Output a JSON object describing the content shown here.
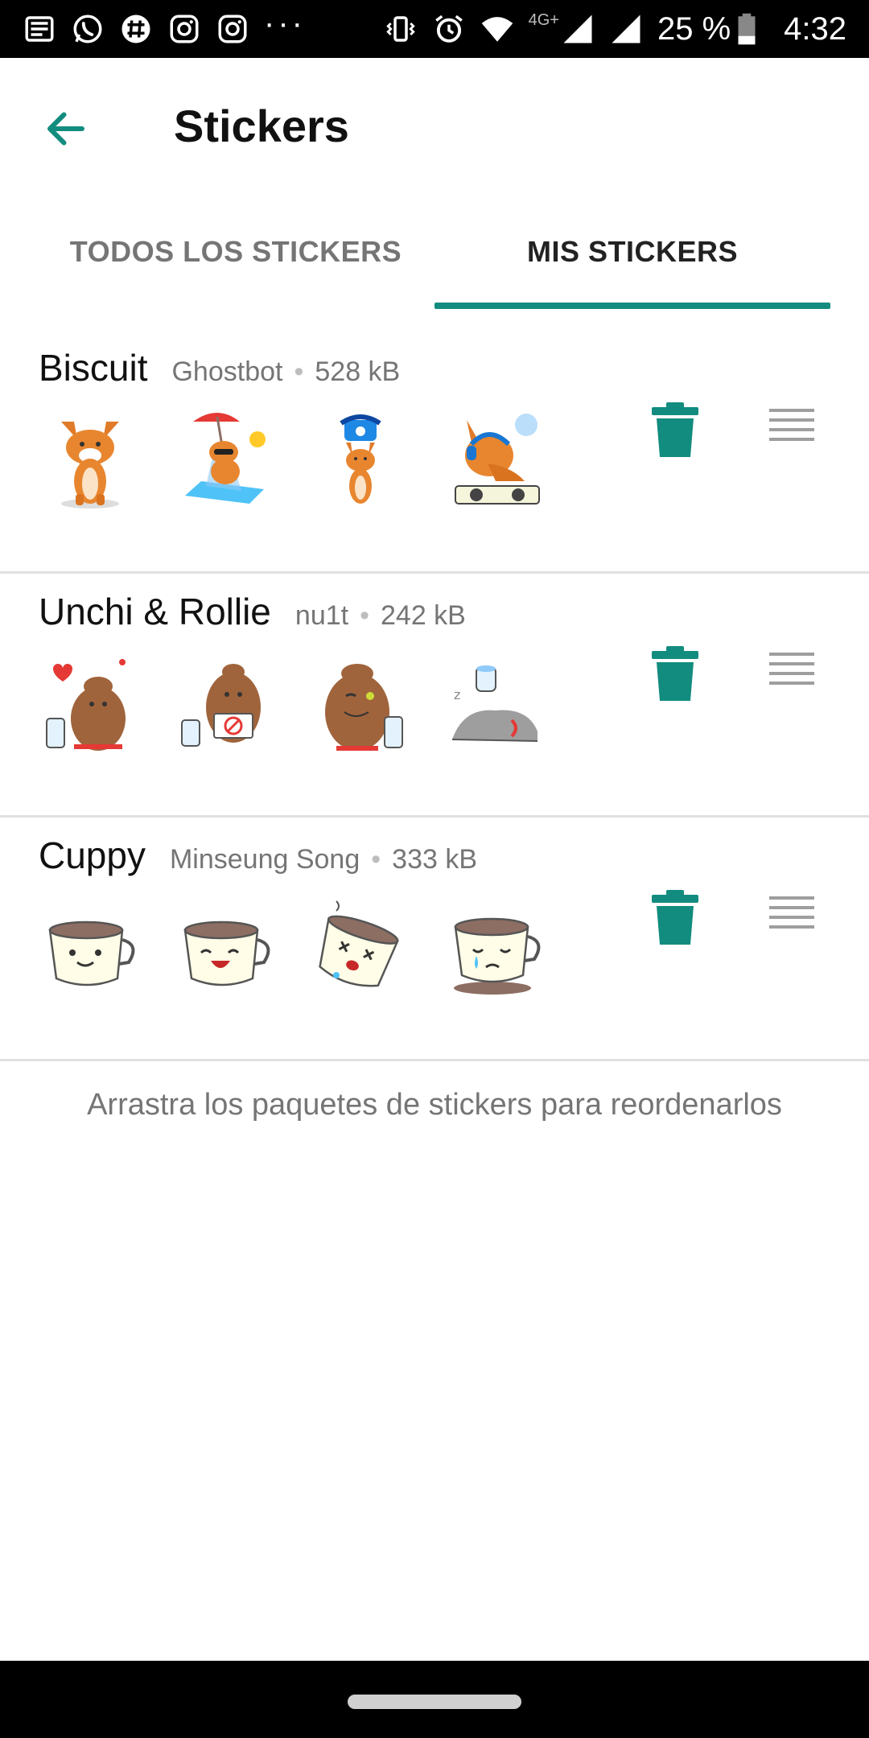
{
  "status_bar": {
    "left_icons": [
      "news-icon",
      "whatsapp-icon",
      "slack-icon",
      "instagram-icon",
      "instagram-icon",
      "more-dots-icon"
    ],
    "more_dots": "···",
    "network_label": "4G+",
    "battery_percent": "25 %",
    "time": "4:32"
  },
  "app_bar": {
    "back_icon": "arrow-back-icon",
    "title": "Stickers"
  },
  "tabs": [
    {
      "label": "TODOS LOS STICKERS",
      "selected": false
    },
    {
      "label": "MIS STICKERS",
      "selected": true
    }
  ],
  "packs": [
    {
      "name": "Biscuit",
      "author": "Ghostbot",
      "size": "528 kB",
      "stickers": [
        "fox-sitting",
        "fox-beach",
        "fox-phone",
        "fox-dj"
      ]
    },
    {
      "name": "Unchi & Rollie",
      "author": "nu1t",
      "size": "242 kB",
      "stickers": [
        "poop-love",
        "poop-sign",
        "poop-wink",
        "roll-sleep"
      ]
    },
    {
      "name": "Cuppy",
      "author": "Minseung Song",
      "size": "333 kB",
      "stickers": [
        "cup-smile",
        "cup-laugh",
        "cup-dizzy",
        "cup-cry"
      ]
    }
  ],
  "meta_separator": "•",
  "hint": "Arrastra los paquetes de stickers para reordenarlos",
  "colors": {
    "accent": "#128c7e",
    "status_bar": "#000000",
    "text_secondary": "#757575",
    "divider": "#e0e0e0"
  }
}
